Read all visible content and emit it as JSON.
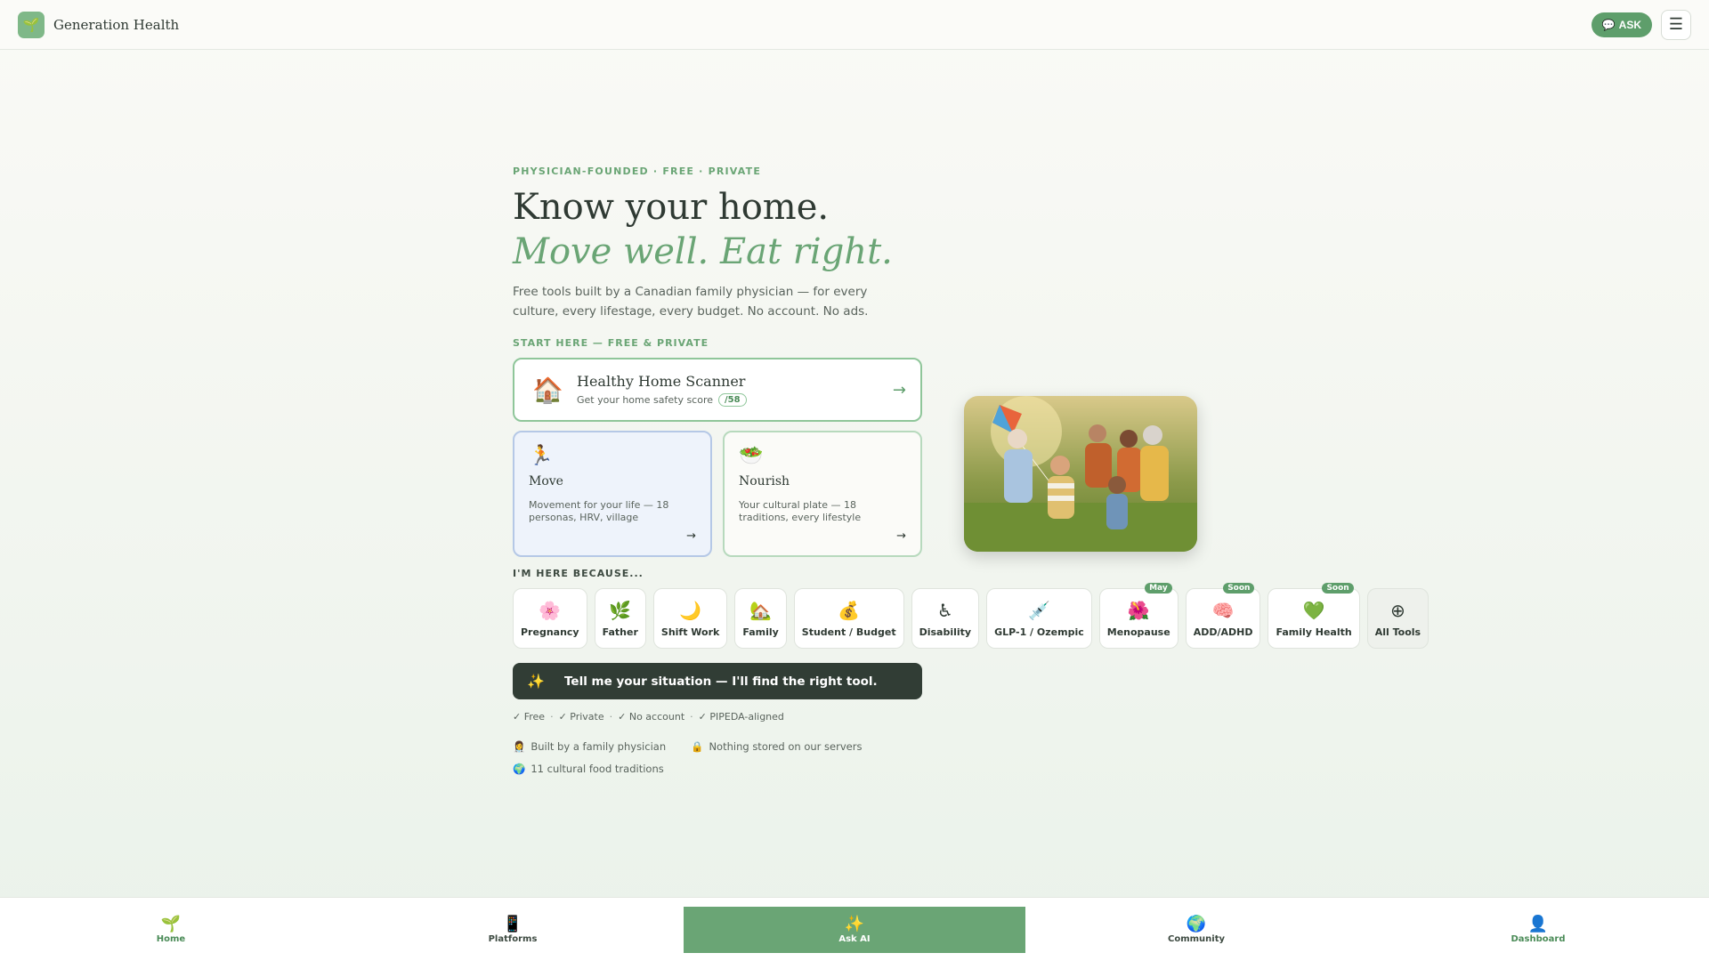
{
  "header": {
    "brand": "Generation Health",
    "logo_glyph": "🌱",
    "ask_label": "ASK",
    "ask_glyph": "💬",
    "menu_glyph": "☰"
  },
  "hero": {
    "eyebrow": "PHYSICIAN-FOUNDED · FREE · PRIVATE",
    "title_line1": "Know your home.",
    "title_line2": "Move well. Eat right.",
    "lede": "Free tools built by a Canadian family physician — for every culture, every lifestage, every budget. No account. No ads.",
    "start_label": "START HERE — FREE & PRIVATE"
  },
  "scanner": {
    "icon": "🏠",
    "title": "Healthy Home Scanner",
    "subtitle": "Get your home safety score",
    "score_pill": "/58",
    "arrow": "→"
  },
  "cards": {
    "move": {
      "icon": "🏃",
      "title": "Move",
      "desc": "Movement for your life — 18 personas, HRV, village",
      "arrow": "→"
    },
    "nourish": {
      "icon": "🥗",
      "title": "Nourish",
      "desc": "Your cultural plate — 18 traditions, every lifestyle",
      "arrow": "→"
    }
  },
  "because_label": "I'M HERE BECAUSE...",
  "chips": [
    {
      "icon": "🌸",
      "label": "Pregnancy",
      "badge": ""
    },
    {
      "icon": "🌿",
      "label": "Father",
      "badge": ""
    },
    {
      "icon": "🌙",
      "label": "Shift Work",
      "badge": ""
    },
    {
      "icon": "🏡",
      "label": "Family",
      "badge": ""
    },
    {
      "icon": "💰",
      "label": "Student / Budget",
      "badge": ""
    },
    {
      "icon": "♿",
      "label": "Disability",
      "badge": ""
    },
    {
      "icon": "💉",
      "label": "GLP-1 / Ozempic",
      "badge": ""
    },
    {
      "icon": "🌺",
      "label": "Menopause",
      "badge": "May"
    },
    {
      "icon": "🧠",
      "label": "ADD/ADHD",
      "badge": "Soon"
    },
    {
      "icon": "💚",
      "label": "Family Health",
      "badge": "Soon"
    },
    {
      "icon": "⊕",
      "label": "All Tools",
      "badge": ""
    }
  ],
  "situation": {
    "icon": "✨",
    "label": "Tell me your situation — I'll find the right tool."
  },
  "checks": [
    "✓ Free",
    "✓ Private",
    "✓ No account",
    "✓ PIPEDA-aligned"
  ],
  "trust": {
    "physician": {
      "icon": "👩‍⚕️",
      "label": "Built by a family physician"
    },
    "servers": {
      "icon": "🔒",
      "label": "Nothing stored on our servers"
    },
    "traditions": {
      "icon": "🌍",
      "label": "11 cultural food traditions"
    }
  },
  "bottom_nav": [
    {
      "icon": "🌱",
      "label": "Home"
    },
    {
      "icon": "📱",
      "label": "Platforms"
    },
    {
      "icon": "✨",
      "label": "Ask AI"
    },
    {
      "icon": "🌍",
      "label": "Community"
    },
    {
      "icon": "👤",
      "label": "Dashboard"
    }
  ],
  "colors": {
    "accent": "#6aa575",
    "dark": "#313d35",
    "move_bg": "#eef3fb"
  }
}
